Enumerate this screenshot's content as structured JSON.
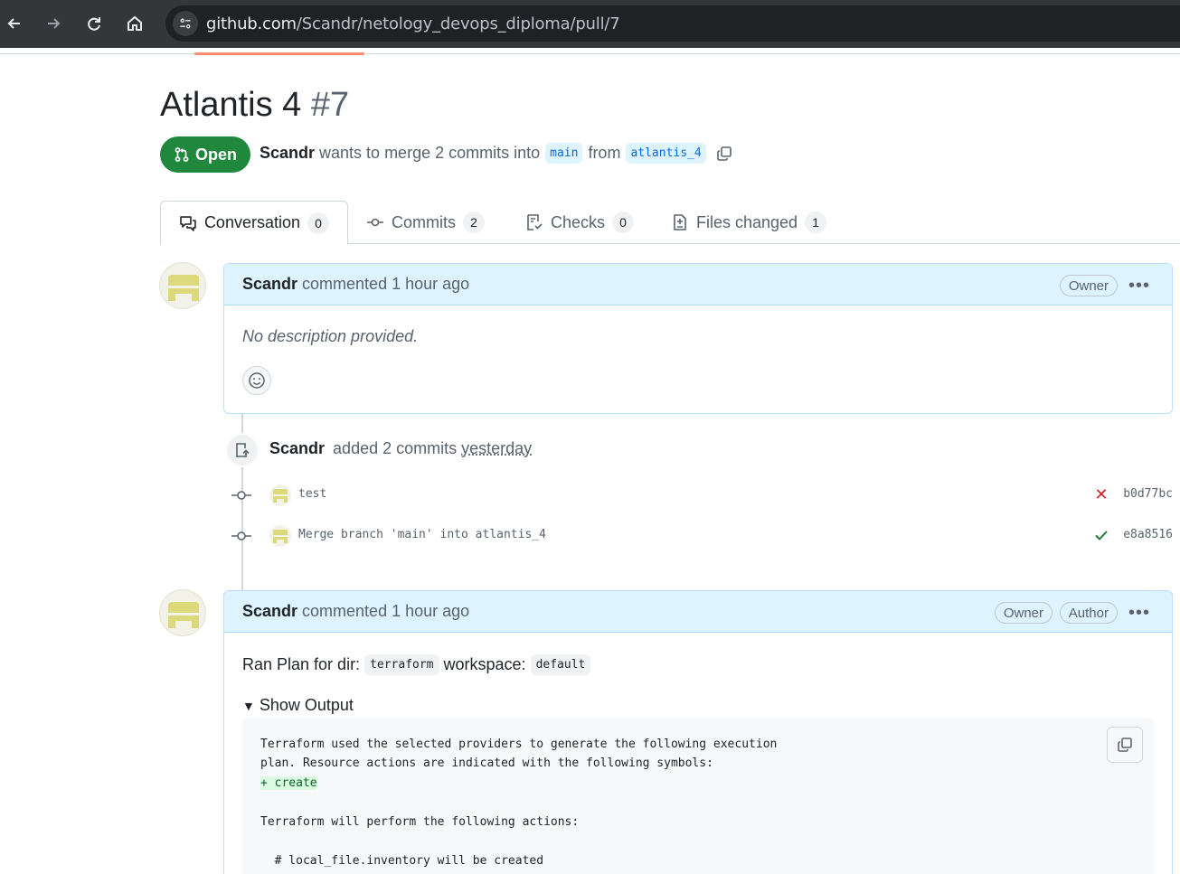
{
  "browser": {
    "url_host": "github.com",
    "url_path": "/Scandr/netology_devops_diploma/pull/7"
  },
  "pr": {
    "title": "Atlantis 4",
    "number": "#7",
    "state": "Open",
    "author": "Scandr",
    "merge_text": "wants to merge 2 commits into",
    "base_branch": "main",
    "from_text": "from",
    "head_branch": "atlantis_4"
  },
  "tabs": [
    {
      "label": "Conversation",
      "count": "0",
      "icon": "comment-discussion-icon"
    },
    {
      "label": "Commits",
      "count": "2",
      "icon": "git-commit-icon"
    },
    {
      "label": "Checks",
      "count": "0",
      "icon": "checklist-icon"
    },
    {
      "label": "Files changed",
      "count": "1",
      "icon": "file-diff-icon"
    }
  ],
  "comment1": {
    "author": "Scandr",
    "meta": "commented 1 hour ago",
    "badge": "Owner",
    "body": "No description provided."
  },
  "event": {
    "author": "Scandr",
    "text": "added 2 commits",
    "when": "yesterday"
  },
  "commits": [
    {
      "message": "test",
      "status": "fail",
      "sha": "b0d77bc",
      "status_color": "#cf222e"
    },
    {
      "message": "Merge branch 'main' into atlantis_4",
      "status": "success",
      "sha": "e8a8516",
      "status_color": "#1a7f37"
    }
  ],
  "comment2": {
    "author": "Scandr",
    "meta": "commented 1 hour ago",
    "badge_owner": "Owner",
    "badge_author": "Author",
    "plan_prefix": "Ran Plan for dir:",
    "dir": "terraform",
    "workspace_label": "workspace:",
    "workspace": "default",
    "summary": "Show Output",
    "output_lines": [
      "Terraform used the selected providers to generate the following execution",
      "plan. Resource actions are indicated with the following symbols:",
      "+ create",
      "",
      "Terraform will perform the following actions:",
      "",
      "  # local_file.inventory will be created"
    ]
  },
  "colors": {
    "open_green": "#1f883d",
    "link_blue": "#0969da",
    "header_blue": "#ddf4ff",
    "fail_red": "#cf222e",
    "success_green": "#1a7f37"
  }
}
